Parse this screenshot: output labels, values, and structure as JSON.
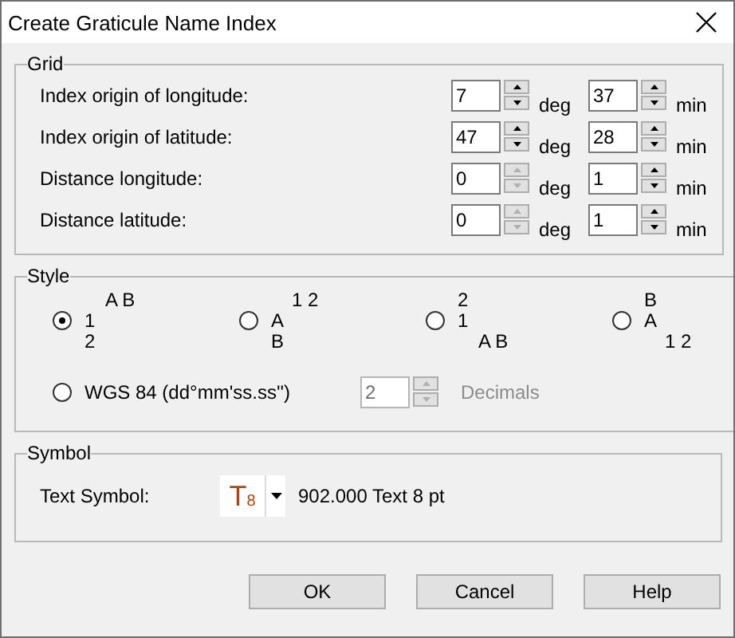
{
  "window": {
    "title": "Create Graticule Name Index"
  },
  "grid": {
    "title": "Grid",
    "rows": [
      {
        "label": "Index origin of longitude:",
        "deg": {
          "value": "7",
          "spin_enabled": true
        },
        "deg_unit": "deg",
        "min": {
          "value": "37",
          "spin_enabled": true
        },
        "min_unit": "min"
      },
      {
        "label": "Index origin of latitude:",
        "deg": {
          "value": "47",
          "spin_enabled": true
        },
        "deg_unit": "deg",
        "min": {
          "value": "28",
          "spin_enabled": true
        },
        "min_unit": "min"
      },
      {
        "label": "Distance longitude:",
        "deg": {
          "value": "0",
          "spin_enabled": false
        },
        "deg_unit": "deg",
        "min": {
          "value": "1",
          "spin_enabled": true
        },
        "min_unit": "min"
      },
      {
        "label": "Distance latitude:",
        "deg": {
          "value": "0",
          "spin_enabled": false
        },
        "deg_unit": "deg",
        "min": {
          "value": "1",
          "spin_enabled": true
        },
        "min_unit": "min"
      }
    ]
  },
  "style": {
    "title": "Style",
    "options": [
      {
        "selected": true,
        "lines": [
          {
            "text": "A B",
            "indented": true
          },
          {
            "text": "1",
            "indented": false
          },
          {
            "text": "2",
            "indented": false
          }
        ]
      },
      {
        "selected": false,
        "lines": [
          {
            "text": "1 2",
            "indented": true
          },
          {
            "text": "A",
            "indented": false
          },
          {
            "text": "B",
            "indented": false
          }
        ]
      },
      {
        "selected": false,
        "lines": [
          {
            "text": "2",
            "indented": false
          },
          {
            "text": "1",
            "indented": false
          },
          {
            "text": "A B",
            "indented": true
          }
        ]
      },
      {
        "selected": false,
        "lines": [
          {
            "text": "B",
            "indented": false
          },
          {
            "text": "A",
            "indented": false
          },
          {
            "text": "1 2",
            "indented": true
          }
        ]
      }
    ],
    "wgs": {
      "label": "WGS 84 (dd°mm'ss.ss'')",
      "selected": false,
      "decimals": {
        "value": "2",
        "disabled": true
      },
      "decimals_label": "Decimals"
    }
  },
  "symbol": {
    "title": "Symbol",
    "label": "Text Symbol:",
    "glyph": "T",
    "glyph_size": "8",
    "description": "902.000 Text 8 pt"
  },
  "buttons": [
    "OK",
    "Cancel",
    "Help"
  ]
}
